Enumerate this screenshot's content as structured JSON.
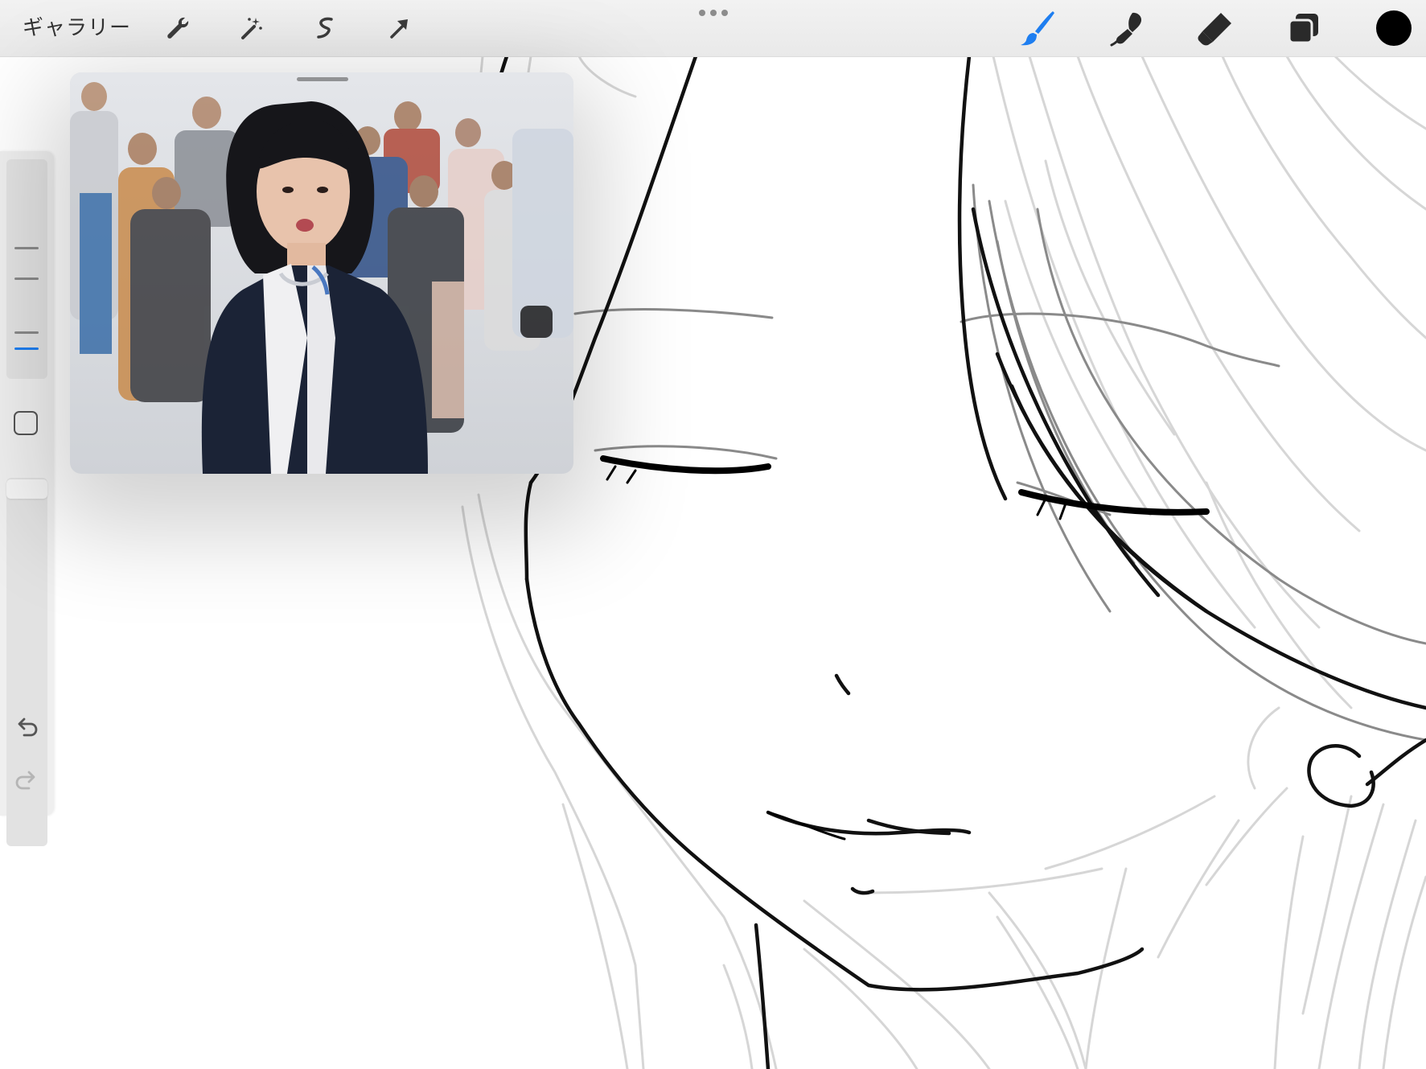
{
  "toolbar": {
    "gallery_label": "ギャラリー",
    "left_icons": [
      "wrench-icon",
      "magic-wand-icon",
      "selection-icon",
      "transform-arrow-icon"
    ],
    "right_icons": [
      "brush-icon",
      "smudge-icon",
      "eraser-icon",
      "layers-icon",
      "color-swatch"
    ],
    "active_tool": "brush",
    "active_color": "#1e7ef0",
    "current_color": "#000000"
  },
  "sidebar": {
    "modify_icon": "square-icon",
    "undo_icon": "undo-icon",
    "redo_icon": "redo-icon",
    "slider_accent": "#1e7ef0"
  },
  "pip": {
    "grabber_icon": "drag-handle"
  }
}
